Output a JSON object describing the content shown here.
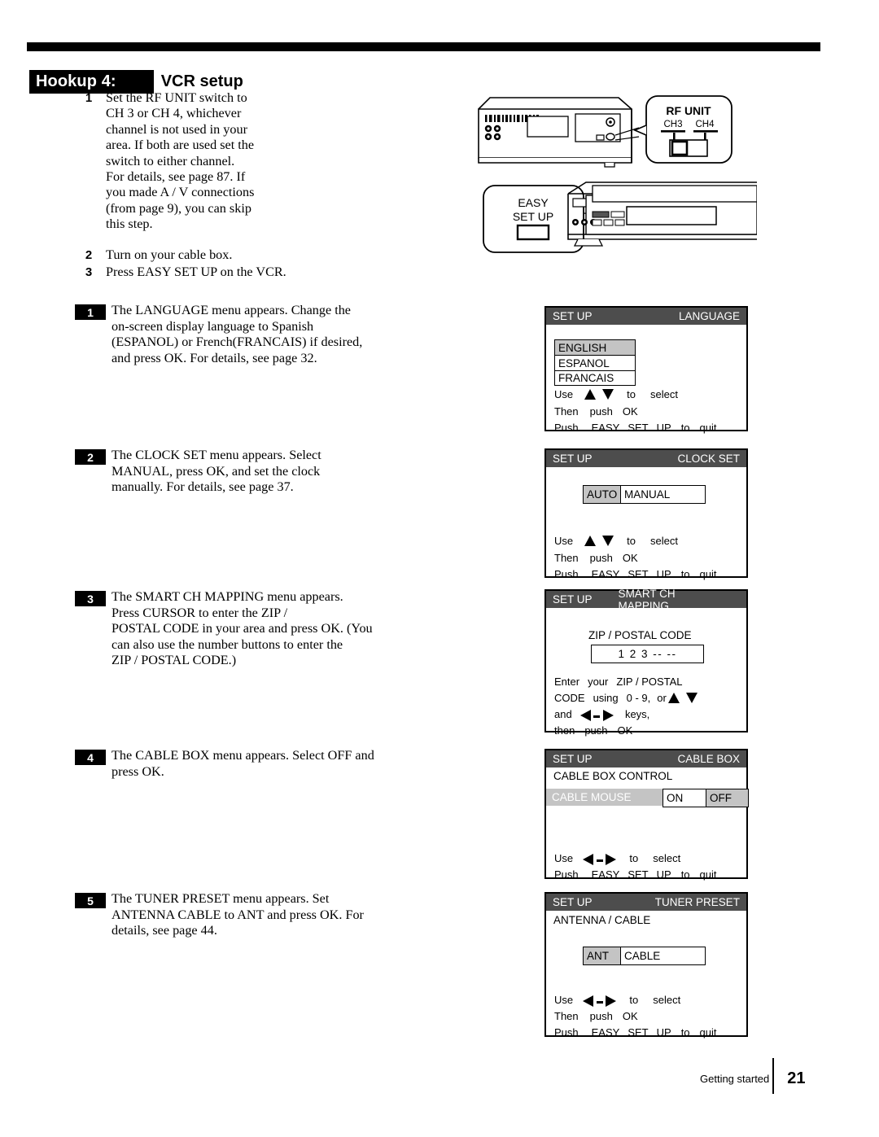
{
  "header": {
    "badge": "Hookup 4:",
    "title": "VCR setup"
  },
  "main_steps": [
    {
      "num": "1",
      "text": "Set the RF UNIT switch to\nCH 3 or CH 4, whichever\nchannel is not used in your\narea.  If both are used set the\nswitch to either channel.\nFor details, see page 87.  If\nyou made A / V connections\n(from page 9), you can skip\nthis step."
    },
    {
      "num": "2",
      "text": "Turn on your cable box."
    },
    {
      "num": "3",
      "text": "Press EASY SET UP on the VCR."
    }
  ],
  "sub_steps": [
    {
      "num": "1",
      "text": "The LANGUAGE menu appears.  Change the\non-screen display language to Spanish\n(ESPANOL) or French(FRANCAIS) if desired,\nand press OK. For details, see page 32."
    },
    {
      "num": "2",
      "text": "The CLOCK SET menu appears.  Select\nMANUAL,  press OK, and set the clock\nmanually.  For details, see page 37."
    },
    {
      "num": "3",
      "text": "The SMART CH MAPPING menu appears.\nPress CURSOR                 to enter the ZIP /\nPOSTAL CODE in your area and press OK.  (You\ncan also use the number buttons to enter the\nZIP / POSTAL CODE.)"
    },
    {
      "num": "4",
      "text": "The CABLE BOX menu appears.  Select OFF and\npress OK."
    },
    {
      "num": "5",
      "text": "The TUNER PRESET menu appears.  Set\nANTENNA CABLE to ANT and press OK.  For\ndetails, see page 44."
    }
  ],
  "illustration": {
    "rf_callout": {
      "title": "RF UNIT",
      "ch_left": "CH3",
      "ch_right": "CH4"
    },
    "easy_callout": {
      "line1": "EASY",
      "line2": "SET UP"
    }
  },
  "osd_screens": [
    {
      "bar_left": "SET UP",
      "bar_right": "LANGUAGE",
      "options": [
        "ENGLISH",
        "ESPANOL",
        "FRANCAIS"
      ],
      "selected": "ENGLISH",
      "hints": {
        "use": "Use",
        "to": "to",
        "select": "select",
        "then": "Then",
        "push": "push",
        "ok": "OK",
        "push2": "Push",
        "easy": "EASY",
        "set": "SET",
        "up": "UP",
        "to2": "to",
        "quit": "quit"
      }
    },
    {
      "bar_left": "SET UP",
      "bar_right": "CLOCK SET",
      "opt_a": "AUTO",
      "opt_b": "MANUAL",
      "selected": "AUTO",
      "hints": {
        "use": "Use",
        "to": "to",
        "select": "select",
        "then": "Then",
        "push": "push",
        "ok": "OK",
        "push2": "Push",
        "easy": "EASY",
        "set": "SET",
        "up": "UP",
        "to2": "to",
        "quit": "quit"
      }
    },
    {
      "bar_left": "SET UP",
      "bar_right": "SMART CH MAPPING",
      "zip_label": "ZIP / POSTAL CODE",
      "zip_value": "1 2 3 -- --",
      "hints": {
        "l1a": "Enter",
        "l1b": "your",
        "l1c": "ZIP / POSTAL",
        "l2a": "CODE",
        "l2b": "using",
        "l2c": "0 - 9,",
        "l2d": "or",
        "l3a": "and",
        "l3b": "keys,",
        "l4a": "then",
        "l4b": "push",
        "l4c": "OK"
      }
    },
    {
      "bar_left": "SET UP",
      "bar_right": "CABLE BOX",
      "subtitle": "CABLE BOX CONTROL",
      "row_label": "CABLE MOUSE",
      "opt_a": "ON",
      "opt_b": "OFF",
      "selected": "OFF",
      "hints": {
        "use": "Use",
        "to": "to",
        "select": "select",
        "push2": "Push",
        "easy": "EASY",
        "set": "SET",
        "up": "UP",
        "to2": "to",
        "quit": "quit"
      }
    },
    {
      "bar_left": "SET UP",
      "bar_right": "TUNER PRESET",
      "subtitle": "ANTENNA / CABLE",
      "opt_a": "ANT",
      "opt_b": "CABLE",
      "selected": "ANT",
      "hints": {
        "use": "Use",
        "to": "to",
        "select": "select",
        "then": "Then",
        "push": "push",
        "ok": "OK",
        "push2": "Push",
        "easy": "EASY",
        "set": "SET",
        "up": "UP",
        "to2": "to",
        "quit": "quit"
      }
    }
  ],
  "footer": {
    "label": "Getting started",
    "page": "21"
  }
}
